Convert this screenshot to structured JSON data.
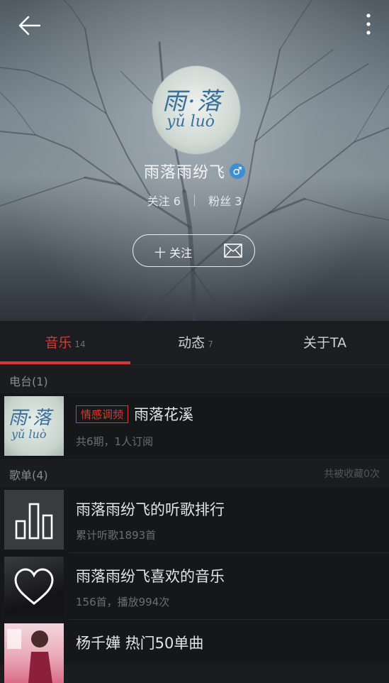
{
  "header": {
    "avatar_text_top": "雨·落",
    "avatar_text_bottom": "yǔ luò",
    "username": "雨落雨纷飞",
    "gender_symbol": "♂",
    "following_label": "关注 6",
    "fans_label": "粉丝 3",
    "follow_button_label": "十 关注"
  },
  "tabs": [
    {
      "label": "音乐",
      "count": "14",
      "active": true
    },
    {
      "label": "动态",
      "count": "7",
      "active": false
    },
    {
      "label": "关于TA",
      "count": "",
      "active": false
    }
  ],
  "radio_section": {
    "title": "电台(1)",
    "items": [
      {
        "tag": "情感调频",
        "title": "雨落花溪",
        "subtitle": "共6期，1人订阅",
        "thumb_text_top": "雨·落",
        "thumb_text_bottom": "yǔ luò"
      }
    ]
  },
  "playlist_section": {
    "title": "歌单(4)",
    "right_text": "共被收藏0次",
    "items": [
      {
        "title": "雨落雨纷飞的听歌排行",
        "subtitle": "累计听歌1893首",
        "icon": "bar-chart-icon"
      },
      {
        "title": "雨落雨纷飞喜欢的音乐",
        "subtitle": "156首，播放994次",
        "icon": "heart-icon"
      },
      {
        "title": "杨千嬅 热门50单曲",
        "subtitle": "",
        "icon": "album-cover"
      }
    ]
  },
  "colors": {
    "accent": "#d63a31",
    "gender": "#3c8fd0",
    "background": "#1b1c1f"
  }
}
